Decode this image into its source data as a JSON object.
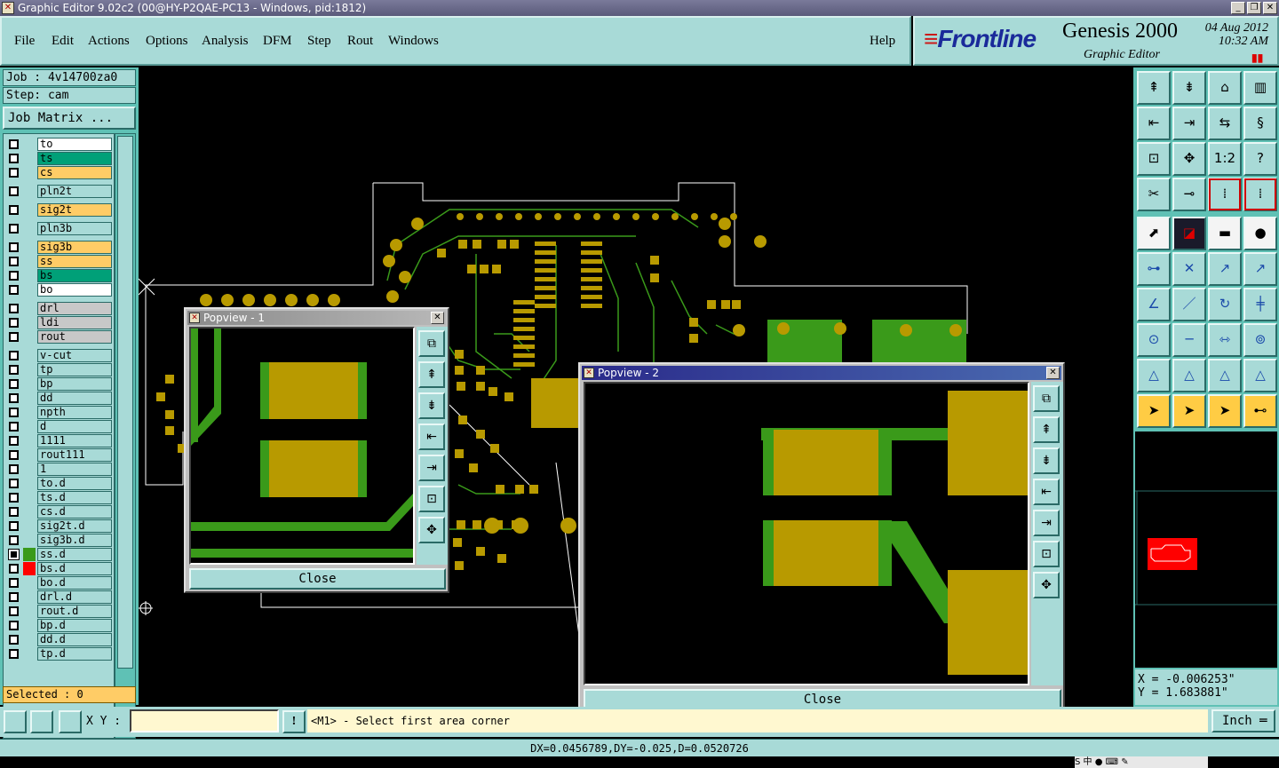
{
  "window": {
    "title": "Graphic Editor 9.02c2 (00@HY-P2QAE-PC13 - Windows, pid:1812)"
  },
  "menu": [
    "File",
    "Edit",
    "Actions",
    "Options",
    "Analysis",
    "DFM",
    "Step",
    "Rout",
    "Windows"
  ],
  "help_label": "Help",
  "brand": {
    "logo": "Frontline",
    "product": "Genesis 2000",
    "subtitle": "Graphic Editor",
    "date": "04 Aug 2012",
    "time": "10:32 AM"
  },
  "job": {
    "job_label": "Job : 4v14700za0",
    "step_label": "Step: cam",
    "matrix_button": "Job Matrix ..."
  },
  "layers": [
    {
      "name": "to",
      "color": "#ffffff"
    },
    {
      "name": "ts",
      "color": "#00a078"
    },
    {
      "name": "cs",
      "color": "#ffcc66"
    },
    {
      "name": "pln2t",
      "color": "#a8dad7"
    },
    {
      "name": "sig2t",
      "color": "#ffcc66"
    },
    {
      "name": "pln3b",
      "color": "#a8dad7"
    },
    {
      "name": "sig3b",
      "color": "#ffcc66"
    },
    {
      "name": "ss",
      "color": "#ffcc66"
    },
    {
      "name": "bs",
      "color": "#00a078"
    },
    {
      "name": "bo",
      "color": "#ffffff"
    },
    {
      "name": "drl",
      "color": "#c8c8c8"
    },
    {
      "name": "ldi",
      "color": "#c8c8c8"
    },
    {
      "name": "rout",
      "color": "#c8c8c8"
    },
    {
      "name": "v-cut",
      "color": "#a8dad7"
    },
    {
      "name": "tp",
      "color": "#a8dad7"
    },
    {
      "name": "bp",
      "color": "#a8dad7"
    },
    {
      "name": "dd",
      "color": "#a8dad7"
    },
    {
      "name": "npth",
      "color": "#a8dad7"
    },
    {
      "name": "d",
      "color": "#a8dad7"
    },
    {
      "name": "1111",
      "color": "#a8dad7"
    },
    {
      "name": "rout111",
      "color": "#a8dad7"
    },
    {
      "name": "1",
      "color": "#a8dad7"
    },
    {
      "name": "to.d",
      "color": "#a8dad7"
    },
    {
      "name": "ts.d",
      "color": "#a8dad7"
    },
    {
      "name": "cs.d",
      "color": "#a8dad7"
    },
    {
      "name": "sig2t.d",
      "color": "#a8dad7"
    },
    {
      "name": "sig3b.d",
      "color": "#a8dad7"
    },
    {
      "name": "ss.d",
      "color": "#a8dad7"
    },
    {
      "name": "bs.d",
      "color": "#a8dad7"
    },
    {
      "name": "bo.d",
      "color": "#a8dad7"
    },
    {
      "name": "drl.d",
      "color": "#a8dad7"
    },
    {
      "name": "rout.d",
      "color": "#a8dad7"
    },
    {
      "name": "bp.d",
      "color": "#a8dad7"
    },
    {
      "name": "dd.d",
      "color": "#a8dad7"
    },
    {
      "name": "tp.d",
      "color": "#a8dad7"
    }
  ],
  "selected_label": "Selected : 0",
  "popview1": {
    "title": "Popview - 1",
    "close": "Close"
  },
  "popview2": {
    "title": "Popview - 2",
    "close": "Close"
  },
  "coords": {
    "x": "X = -0.006253\"",
    "y": "Y = 1.683881\""
  },
  "command": {
    "xy_label": "X Y :",
    "xy_value": "",
    "message": "<M1> - Select first area corner",
    "units": "Inch"
  },
  "status": "DX=0.0456789,DY=-0.025,D=0.0520726",
  "tray": "S 中 ● ⌨ ✎",
  "colors": {
    "panel": "#a8dad7",
    "panel_dark": "#5fc1b5",
    "copper": "#b89a00",
    "trace": "#3a9a1a",
    "highlight": "#ffcc66"
  }
}
